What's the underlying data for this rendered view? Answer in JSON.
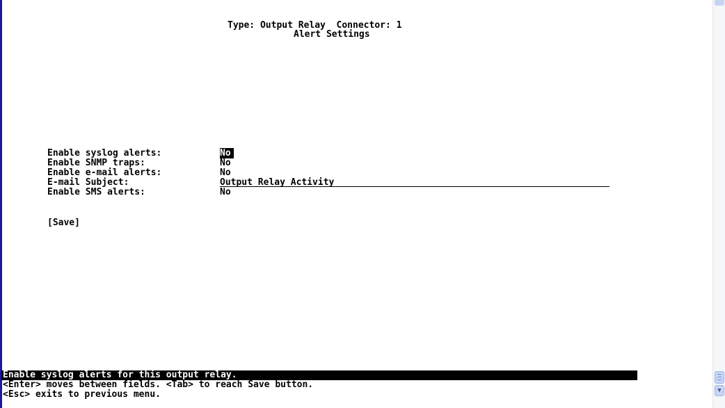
{
  "header": {
    "line1": "Type: Output Relay  Connector: 1",
    "line2": "Alert Settings"
  },
  "form": {
    "fields": [
      {
        "label": "Enable syslog alerts:",
        "value": "No"
      },
      {
        "label": "Enable SNMP traps:",
        "value": "No"
      },
      {
        "label": "Enable e-mail alerts:",
        "value": "No"
      },
      {
        "label": "E-mail Subject:",
        "value": "Output Relay Activity"
      },
      {
        "label": "Enable SMS alerts:",
        "value": "No"
      }
    ],
    "save_label": "[Save]"
  },
  "status": {
    "message": "Enable syslog alerts for this output relay.",
    "help_1": "<Enter> moves between fields. <Tab> to reach Save button.",
    "help_2": "<Esc> exits to previous menu."
  },
  "scrollbar": {
    "down_icon": "chevron-down-icon"
  },
  "colors": {
    "background": "#ffffff",
    "text": "#000000",
    "highlight": "#000000",
    "left_edge": "#1a1aa0"
  }
}
